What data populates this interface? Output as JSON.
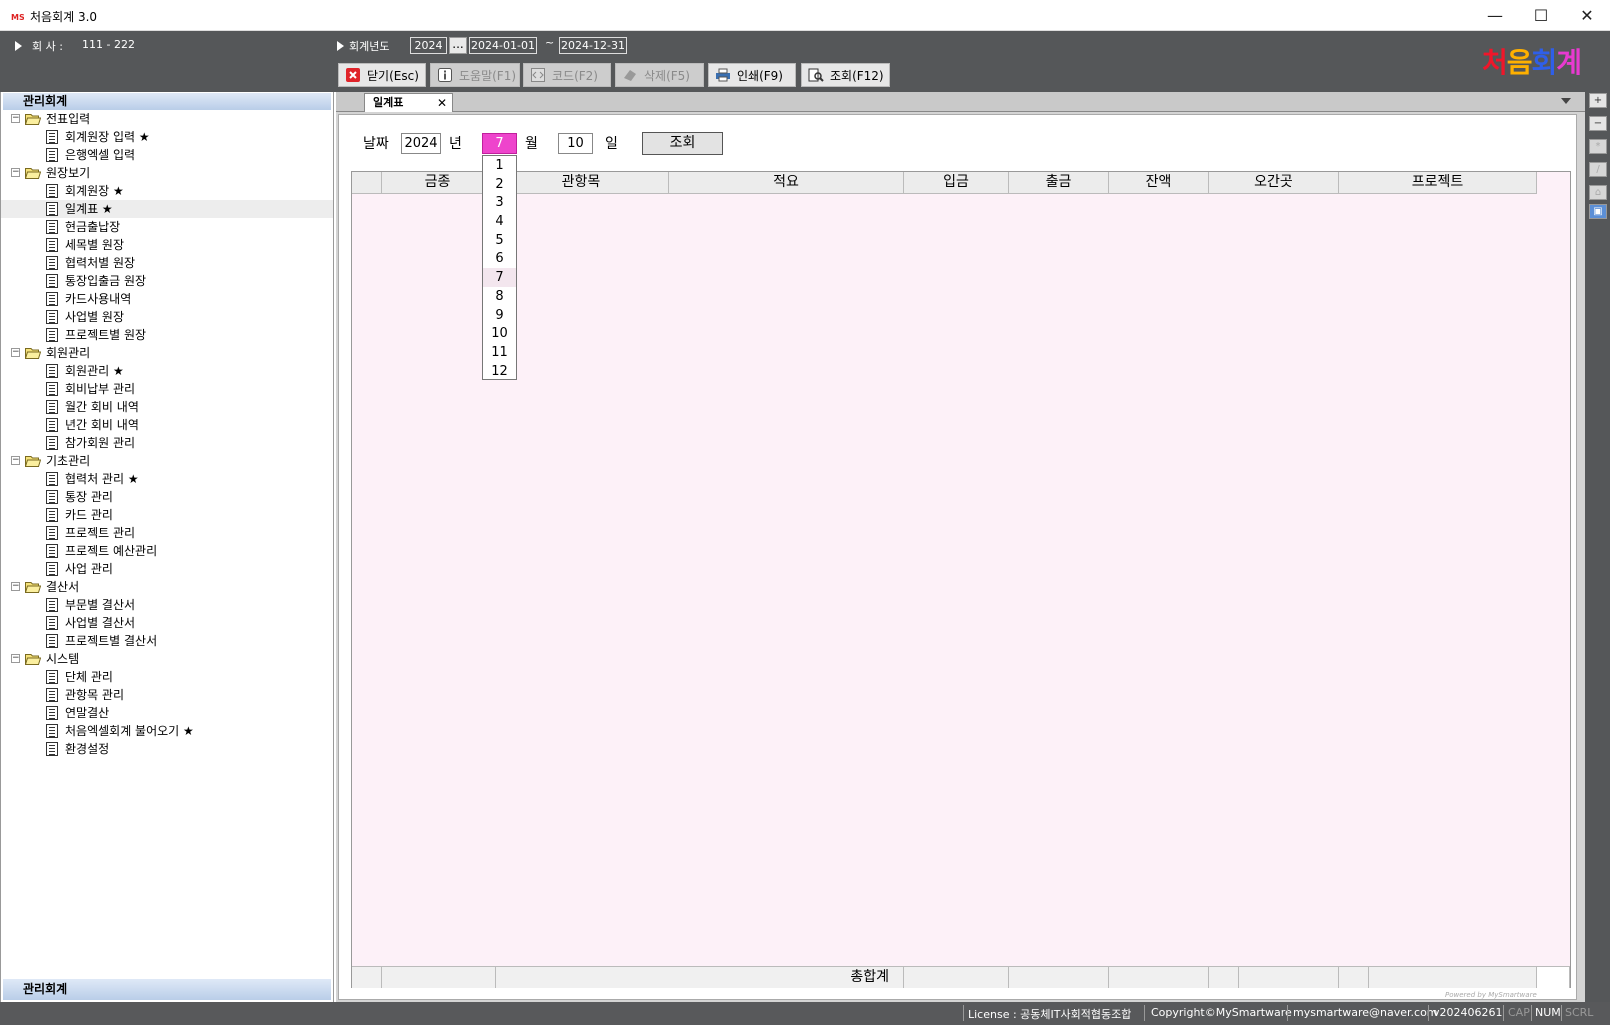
{
  "window": {
    "title": "처음회계 3.0",
    "minimize": "—",
    "maximize": "☐",
    "close": "✕"
  },
  "header": {
    "company_label": "회  사 :",
    "company_value": "111 - 222",
    "fiscal_label": "회계년도",
    "fiscal_year": "2024",
    "dots": "...",
    "date_from": "2024-01-01",
    "tilde": "~",
    "date_to": "2024-12-31",
    "logo": "처음회계",
    "buttons": [
      {
        "label": "닫기(Esc)",
        "icon": "close-red-icon",
        "disabled": false
      },
      {
        "label": "도움말(F1)",
        "icon": "info-icon",
        "disabled": true
      },
      {
        "label": "코드(F2)",
        "icon": "code-icon",
        "disabled": true
      },
      {
        "label": "삭제(F5)",
        "icon": "eraser-icon",
        "disabled": true
      },
      {
        "label": "인쇄(F9)",
        "icon": "printer-icon",
        "disabled": false
      },
      {
        "label": "조회(F12)",
        "icon": "search-doc-icon",
        "disabled": false
      }
    ]
  },
  "sidebar": {
    "title": "관리회계",
    "footer": "관리회계",
    "tree": [
      {
        "type": "cat",
        "label": "전표입력"
      },
      {
        "type": "item",
        "label": "회계원장 입력 ★"
      },
      {
        "type": "item",
        "label": "은행엑셀 입력"
      },
      {
        "type": "cat",
        "label": "원장보기"
      },
      {
        "type": "item",
        "label": "회계원장 ★"
      },
      {
        "type": "item",
        "label": "일계표 ★",
        "selected": true
      },
      {
        "type": "item",
        "label": "현금출납장"
      },
      {
        "type": "item",
        "label": "세목별 원장"
      },
      {
        "type": "item",
        "label": "협력처별 원장"
      },
      {
        "type": "item",
        "label": "통장입출금 원장"
      },
      {
        "type": "item",
        "label": "카드사용내역"
      },
      {
        "type": "item",
        "label": "사업별 원장"
      },
      {
        "type": "item",
        "label": "프로젝트별 원장"
      },
      {
        "type": "cat",
        "label": "회원관리"
      },
      {
        "type": "item",
        "label": "회원관리 ★"
      },
      {
        "type": "item",
        "label": "회비납부 관리"
      },
      {
        "type": "item",
        "label": "월간 회비 내역"
      },
      {
        "type": "item",
        "label": "년간 회비 내역"
      },
      {
        "type": "item",
        "label": "참가회원 관리"
      },
      {
        "type": "cat",
        "label": "기초관리"
      },
      {
        "type": "item",
        "label": "협력처 관리 ★"
      },
      {
        "type": "item",
        "label": "통장 관리"
      },
      {
        "type": "item",
        "label": "카드 관리"
      },
      {
        "type": "item",
        "label": "프로젝트 관리"
      },
      {
        "type": "item",
        "label": "프로젝트 예산관리"
      },
      {
        "type": "item",
        "label": "사업 관리"
      },
      {
        "type": "cat",
        "label": "결산서"
      },
      {
        "type": "item",
        "label": "부문별 결산서"
      },
      {
        "type": "item",
        "label": "사업별 결산서"
      },
      {
        "type": "item",
        "label": "프로젝트별 결산서"
      },
      {
        "type": "cat",
        "label": "시스템"
      },
      {
        "type": "item",
        "label": "단체 관리"
      },
      {
        "type": "item",
        "label": "관항목 관리"
      },
      {
        "type": "item",
        "label": "연말결산"
      },
      {
        "type": "item",
        "label": "처음엑셀회계 불어오기 ★"
      },
      {
        "type": "item",
        "label": "환경설정"
      }
    ]
  },
  "tab": {
    "label": "일계표",
    "close": "✕"
  },
  "form": {
    "date_label": "날짜",
    "year": "2024",
    "year_unit": "년",
    "month": "7",
    "month_unit": "월",
    "day": "10",
    "day_unit": "일",
    "query_button": "조회"
  },
  "month_options": [
    "1",
    "2",
    "3",
    "4",
    "5",
    "6",
    "7",
    "8",
    "9",
    "10",
    "11",
    "12"
  ],
  "selected_month_index": 6,
  "grid": {
    "columns": [
      "",
      "금종",
      "관항목",
      "적요",
      "입금",
      "출금",
      "잔액",
      "오간곳",
      "프로젝트"
    ],
    "total_label": "총합계"
  },
  "powered": "Powered by MySmartware",
  "rightbar": [
    "+",
    "−",
    "*",
    "/",
    "⌂",
    "▣"
  ],
  "status": {
    "license": "License : 공동체IT사회적협동조합",
    "copyright": "Copyright©MySmartware",
    "email": "mysmartware@naver.com",
    "version": "v202406261",
    "cap": "CAP",
    "num": "NUM",
    "scrl": "SCRL"
  },
  "colors": {
    "header_bg": "#555759",
    "active_month": "#ee44cc",
    "grid_bg": "#fdf1f8"
  }
}
